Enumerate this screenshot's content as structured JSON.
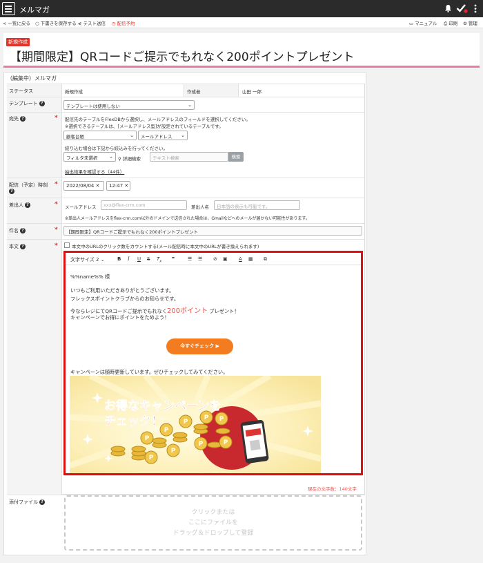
{
  "app": {
    "title": "メルマガ"
  },
  "toolbar": {
    "back": "一覧に戻る",
    "save_draft": "下書きを保存する",
    "test_send": "テスト送信",
    "schedule": "配信予約",
    "manual": "マニュアル",
    "print": "印刷",
    "admin": "管理"
  },
  "header": {
    "badge": "新規作成",
    "title": "【期間限定】QRコードご提示でもれなく200ポイントプレゼント"
  },
  "form": {
    "heading": "（編集中）メルマガ",
    "status": {
      "label": "ステータス",
      "value": "新規作成",
      "author_label": "作成者",
      "author_value": "山田 一郎"
    },
    "template": {
      "label": "テンプレート",
      "value": "テンプレートは使用しない"
    },
    "recipient": {
      "label": "宛先",
      "note1": "配信先のテーブルをFlexDBから選択し、メールアドレスのフィールドを選択してください。",
      "note2": "※選択できるテーブルは、[メールアドレス型]が設定されているテーブルです。",
      "table_value": "顧客台帳",
      "field_value": "メールアドレス",
      "filter_note": "絞り込む場合は下記から絞込みを行ってください。",
      "filter_value": "フィルタ未選択",
      "advanced_search": "詳細検索",
      "search_placeholder": "テキスト検索",
      "search_button": "検索",
      "result_link": "抽出結果を確認する（44件）"
    },
    "schedule": {
      "label": "配信（予定）時刻",
      "date": "2022/08/04",
      "time": "12:47"
    },
    "sender": {
      "label": "差出人",
      "email_label": "メールアドレス",
      "email_placeholder": "xxx@flex-crm.com",
      "name_label": "差出人名",
      "name_placeholder": "日本語の表示も可能です。",
      "note": "※差出人メールアドレスをflex-crm.com以外のドメインで送信された場合は、Gmailなどへのメールが届かない可能性があります。"
    },
    "subject": {
      "label": "件名",
      "value": "【期間限定】QRコードご提示でもれなく200ポイントプレゼント"
    },
    "body": {
      "label": "本文",
      "track_label": "本文中のURLのクリック数をカウントする(メール配信時に本文中のURLが書き換えられます)",
      "font_size": "文字サイズ 2",
      "greeting": "%%name%% 様",
      "line1": "いつもご利用いただきありがとうございます。",
      "line2": "フレックスポイントクラブからのお知らせです。",
      "line3_a": "今ならレジにてQRコードご提示でもれなく",
      "line3_hl": "200ポイント",
      "line3_b": " プレゼント！",
      "line4": "キャンペーンでお得にポイントをためよう！",
      "cta": "今すぐチェック ▶",
      "footer_line": "キャンペーンは随時更新しています。ぜひチェックしてみてください。",
      "banner_line1": "お得なキャンペーンを",
      "banner_line2": "チェック！",
      "char_count": "現在の文字数：140文字"
    },
    "attachment": {
      "label": "添付ファイル",
      "drop_line1": "クリックまたは",
      "drop_line2": "ここにファイルを",
      "drop_line3": "ドラッグ＆ドロップして登録"
    }
  },
  "colors": {
    "accent": "#f47c20",
    "required": "#e0342a",
    "highlight": "#e01010"
  }
}
